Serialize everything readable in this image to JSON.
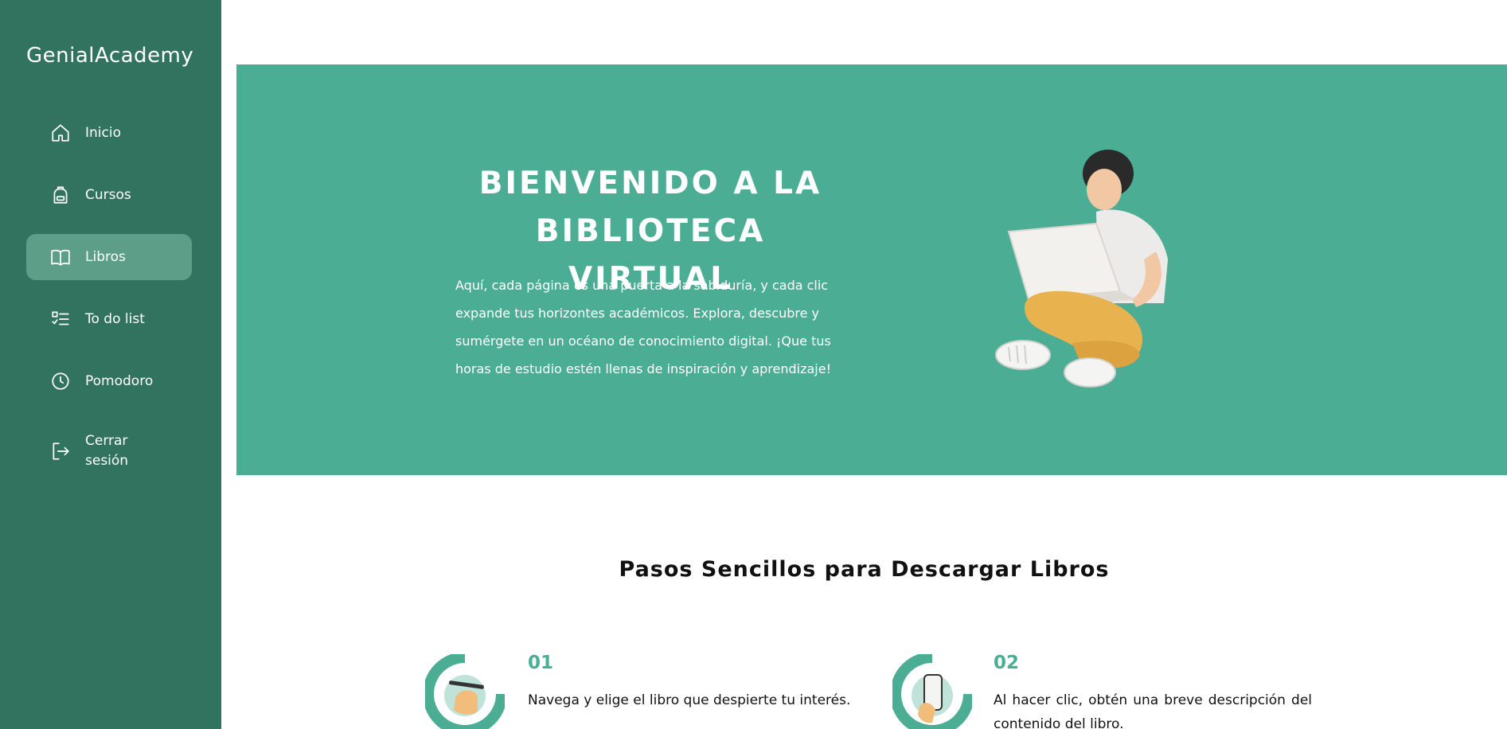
{
  "app": {
    "brand": "GenialAcademy"
  },
  "sidebar": {
    "items": [
      {
        "label": "Inicio",
        "icon": "home-icon",
        "active": false
      },
      {
        "label": "Cursos",
        "icon": "backpack-icon",
        "active": false
      },
      {
        "label": "Libros",
        "icon": "book-icon",
        "active": true
      },
      {
        "label": "To do list",
        "icon": "checklist-icon",
        "active": false
      },
      {
        "label": "Pomodoro",
        "icon": "clock-icon",
        "active": false
      },
      {
        "label": "Cerrar sesión",
        "icon": "logout-icon",
        "active": false
      }
    ]
  },
  "hero": {
    "title": "BIENVENIDO A LA BIBLIOTECA VIRTUAL",
    "text": "Aquí, cada página es una puerta a la sabiduría, y cada clic expande tus horizontes académicos. Explora, descubre y sumérgete en un océano de conocimiento digital. ¡Que tus horas de estudio estén llenas de inspiración y aprendizaje!"
  },
  "steps_section": {
    "title": "Pasos Sencillos para Descargar Libros",
    "steps": [
      {
        "number": "01",
        "text": "Navega y elige el libro que despierte tu interés.",
        "icon": "hand-pen-icon"
      },
      {
        "number": "02",
        "text": "Al hacer clic, obtén una breve descripción del contenido del libro.",
        "icon": "hand-phone-icon"
      }
    ]
  },
  "colors": {
    "sidebar": "#32735f",
    "active": "#5d9e89",
    "hero": "#4cad95",
    "accent": "#4cad95"
  }
}
